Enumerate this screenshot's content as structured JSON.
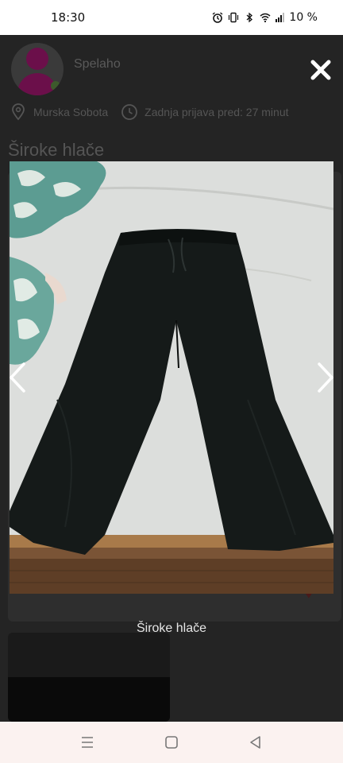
{
  "status_bar": {
    "time": "18:30",
    "battery": "10 %",
    "icons": [
      "alarm-icon",
      "vibrate-icon",
      "bluetooth-icon",
      "wifi-icon",
      "signal-icon"
    ]
  },
  "background_page": {
    "username": "Spelaho",
    "location": "Murska Sobota",
    "last_login": "Zadnja prijava pred: 27 minut",
    "title": "Široke hlače"
  },
  "lightbox": {
    "caption": "Široke hlače",
    "close_icon": "close-icon",
    "prev_icon": "chevron-left-icon",
    "next_icon": "chevron-right-icon"
  },
  "nav_bar": {
    "icons": [
      "menu-icon",
      "home-icon",
      "back-icon"
    ]
  },
  "colors": {
    "overlay": "#242424",
    "accent": "#6b0f4a",
    "nav_bar_bg": "#fbf2f0"
  }
}
